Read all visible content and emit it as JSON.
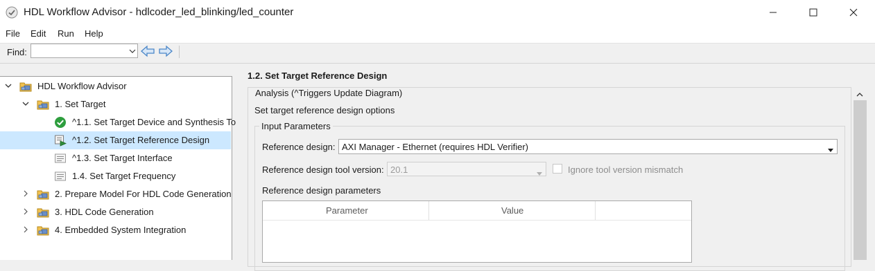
{
  "window": {
    "title": "HDL Workflow Advisor - hdlcoder_led_blinking/led_counter"
  },
  "menu": [
    "File",
    "Edit",
    "Run",
    "Help"
  ],
  "toolbar": {
    "find_label": "Find:",
    "find_value": ""
  },
  "tree": [
    {
      "label": "HDL Workflow Advisor",
      "icon": "folder-icon",
      "twisty": "expanded"
    },
    {
      "label": "1. Set Target",
      "icon": "folder-icon",
      "twisty": "expanded"
    },
    {
      "label": "^1.1. Set Target Device and Synthesis To",
      "icon": "check-icon",
      "twisty": "none"
    },
    {
      "label": "^1.2. Set Target Reference Design",
      "icon": "task-run-icon",
      "twisty": "none",
      "selected": true
    },
    {
      "label": "^1.3. Set Target Interface",
      "icon": "task-icon",
      "twisty": "none"
    },
    {
      "label": "1.4. Set Target Frequency",
      "icon": "task-icon",
      "twisty": "none"
    },
    {
      "label": "2. Prepare Model For HDL Code Generation",
      "icon": "folder-icon",
      "twisty": "collapsed"
    },
    {
      "label": "3. HDL Code Generation",
      "icon": "folder-icon",
      "twisty": "collapsed"
    },
    {
      "label": "4. Embedded System Integration",
      "icon": "folder-icon",
      "twisty": "collapsed"
    }
  ],
  "panel": {
    "title": "1.2. Set Target Reference Design",
    "analysis_legend": "Analysis (^Triggers Update Diagram)",
    "description": "Set target reference design options",
    "input_params_legend": "Input Parameters",
    "reference_design_label": "Reference design:",
    "reference_design_value": "AXI Manager - Ethernet (requires HDL Verifier)",
    "tool_version_label": "Reference design tool version:",
    "tool_version_value": "20.1",
    "ignore_mismatch_label": "Ignore tool version mismatch",
    "ignore_mismatch_checked": false,
    "rd_params_label": "Reference design parameters",
    "table_headers": [
      "Parameter",
      "Value"
    ]
  },
  "colors": {
    "selection": "#cce8ff",
    "check_green": "#2e9e3e",
    "folder_yellow": "#f2c14e",
    "nav_arrow_blue": "#4a86c8"
  }
}
